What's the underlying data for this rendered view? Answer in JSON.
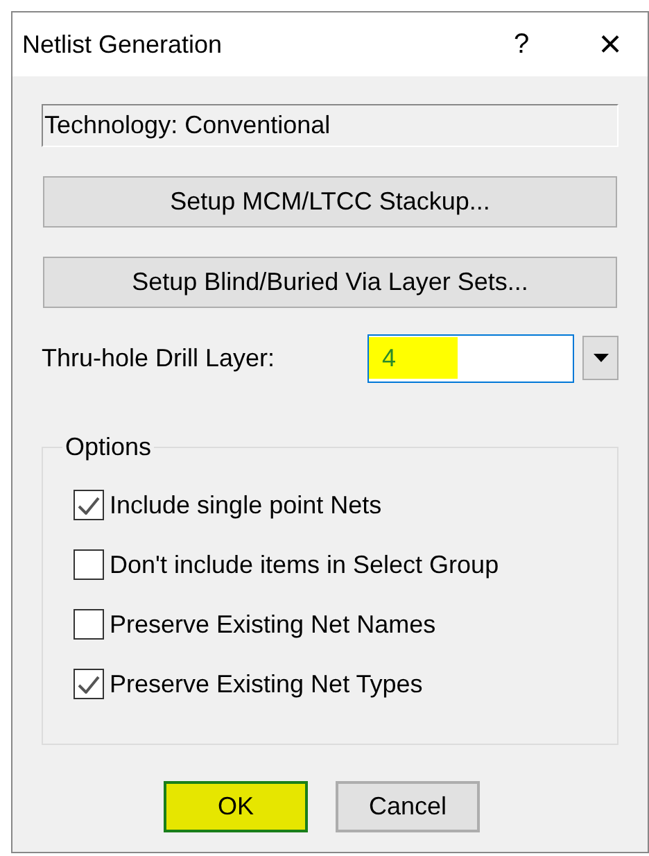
{
  "window": {
    "title": "Netlist Generation",
    "help": "?",
    "close": "×"
  },
  "technology": "Technology: Conventional",
  "setup_buttons": [
    "Setup MCM/LTCC Stackup...",
    "Setup Blind/Buried Via Layer Sets..."
  ],
  "drill_layer": {
    "label": "Thru-hole Drill Layer:",
    "value": "4",
    "highlighted": true
  },
  "options": {
    "title": "Options",
    "items": [
      {
        "label": "Include single point Nets",
        "checked": true
      },
      {
        "label": "Don't include items in Select Group",
        "checked": false
      },
      {
        "label": "Preserve Existing Net Names",
        "checked": false
      },
      {
        "label": "Preserve Existing Net Types",
        "checked": true
      }
    ]
  },
  "buttons": [
    {
      "label": "OK",
      "highlighted": true
    },
    {
      "label": "Cancel",
      "highlighted": false
    }
  ]
}
